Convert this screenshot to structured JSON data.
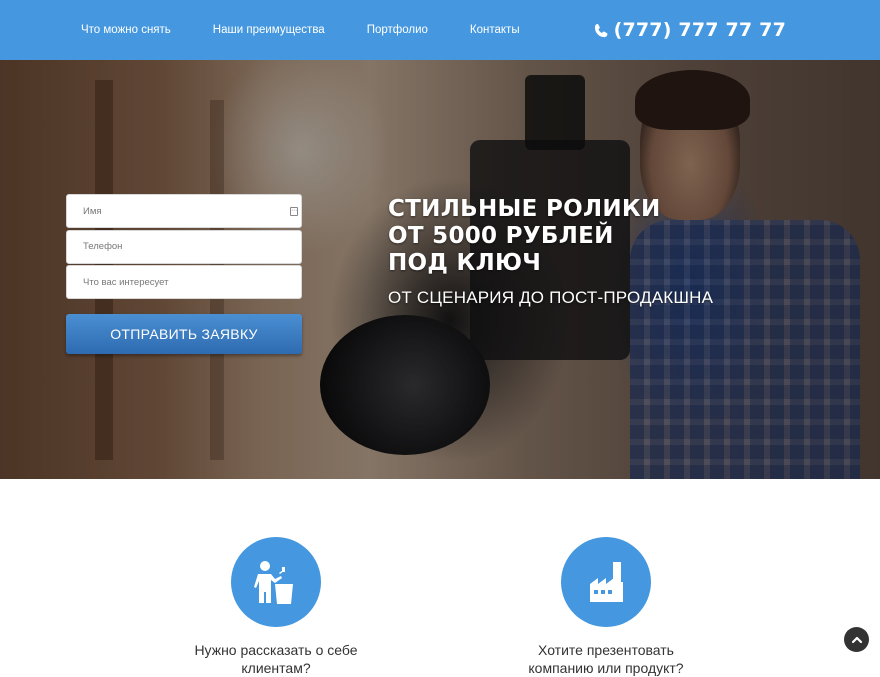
{
  "nav": {
    "items": [
      "Что можно снять",
      "Наши преимущества",
      "Портфолио",
      "Контакты"
    ],
    "phone": "(777) 777 77 77"
  },
  "form": {
    "name_placeholder": "Имя",
    "phone_placeholder": "Телефон",
    "interest_placeholder": "Что вас интересует",
    "submit_label": "ОТПРАВИТЬ ЗАЯВКУ"
  },
  "hero": {
    "headline_lines": [
      "СТИЛЬНЫЕ РОЛИКИ",
      "ОТ 5000 РУБЛЕЙ",
      "ПОД КЛЮЧ"
    ],
    "subheadline": "ОТ СЦЕНАРИЯ ДО ПОСТ-ПРОДАКШНА"
  },
  "features": [
    {
      "icon": "speaker-podium-icon",
      "text": "Нужно рассказать о себе клиентам?"
    },
    {
      "icon": "factory-icon",
      "text": "Хотите презентовать компанию или продукт?"
    }
  ],
  "colors": {
    "accent": "#4598df",
    "button": "#2e6bb0"
  }
}
